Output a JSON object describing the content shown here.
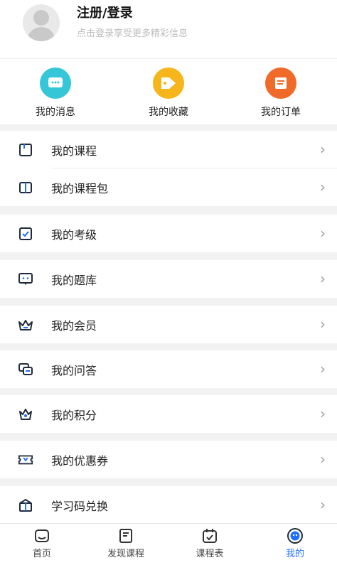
{
  "profile": {
    "title": "注册/登录",
    "subtitle": "点击登录享受更多精彩信息"
  },
  "quick_actions": [
    {
      "label": "我的消息",
      "icon": "message-icon",
      "color": "#35c7d8"
    },
    {
      "label": "我的收藏",
      "icon": "tag-icon",
      "color": "#f5b51b"
    },
    {
      "label": "我的订单",
      "icon": "order-icon",
      "color": "#f06a2a"
    }
  ],
  "menu": {
    "courses": "我的课程",
    "course_packages": "我的课程包",
    "exams": "我的考级",
    "question_bank": "我的题库",
    "membership": "我的会员",
    "qa": "我的问答",
    "points": "我的积分",
    "coupons": "我的优惠券",
    "redeem": "学习码兑换",
    "chevron": "›"
  },
  "tabs": [
    {
      "label": "首页",
      "icon": "home-icon"
    },
    {
      "label": "发现课程",
      "icon": "discover-icon"
    },
    {
      "label": "课程表",
      "icon": "calendar-icon"
    },
    {
      "label": "我的",
      "icon": "profile-icon"
    }
  ],
  "colors": {
    "accent": "#1e6fff"
  }
}
